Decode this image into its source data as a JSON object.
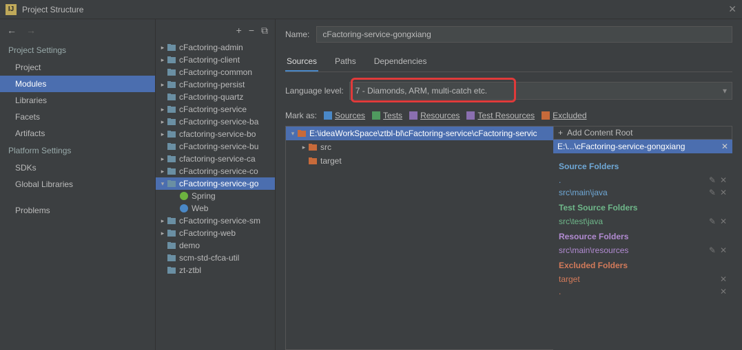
{
  "window": {
    "title": "Project Structure"
  },
  "left": {
    "project_settings_hdr": "Project Settings",
    "items1": [
      "Project",
      "Modules",
      "Libraries",
      "Facets",
      "Artifacts"
    ],
    "platform_hdr": "Platform Settings",
    "items2": [
      "SDKs",
      "Global Libraries"
    ],
    "problems": "Problems"
  },
  "tree": {
    "nodes": [
      {
        "label": "cFactoring-admin",
        "exp": ">"
      },
      {
        "label": "cFactoring-client",
        "exp": ">"
      },
      {
        "label": "cFactoring-common",
        "exp": ""
      },
      {
        "label": "cFactoring-persist",
        "exp": ">"
      },
      {
        "label": "cFactoring-quartz",
        "exp": ""
      },
      {
        "label": "cFactoring-service",
        "exp": ">"
      },
      {
        "label": "cFactoring-service-ba",
        "exp": ">"
      },
      {
        "label": "cfactoring-service-bo",
        "exp": ">"
      },
      {
        "label": "cFactoring-service-bu",
        "exp": ""
      },
      {
        "label": "cfactoring-service-ca",
        "exp": ">"
      },
      {
        "label": "cFactoring-service-co",
        "exp": ">"
      },
      {
        "label": "cFactoring-service-go",
        "exp": "v",
        "sel": true,
        "children": [
          {
            "label": "Spring",
            "icon": "spring"
          },
          {
            "label": "Web",
            "icon": "web"
          }
        ]
      },
      {
        "label": "cFactoring-service-sm",
        "exp": ">"
      },
      {
        "label": "cFactoring-web",
        "exp": ">"
      },
      {
        "label": "demo",
        "exp": ""
      },
      {
        "label": "scm-std-cfca-util",
        "exp": ""
      },
      {
        "label": "zt-ztbl",
        "exp": ""
      }
    ]
  },
  "right": {
    "name_label": "Name:",
    "name_value": "cFactoring-service-gongxiang",
    "tabs": [
      "Sources",
      "Paths",
      "Dependencies"
    ],
    "lang_label": "Language level:",
    "lang_value": "7 - Diamonds, ARM, multi-catch etc.",
    "mark_label": "Mark as:",
    "marks": [
      {
        "label": "Sources",
        "color": "#4a88c7"
      },
      {
        "label": "Tests",
        "color": "#4f9a5f"
      },
      {
        "label": "Resources",
        "color": "#8a6fb0"
      },
      {
        "label": "Test Resources",
        "color": "#8a6fb0"
      },
      {
        "label": "Excluded",
        "color": "#c76a3a"
      }
    ],
    "content_root": "E:\\ideaWorkSpace\\ztbl-bl\\cFactoring-service\\cFactoring-servic",
    "content_children": [
      "src",
      "target"
    ],
    "add_root": "Add Content Root",
    "root_short": "E:\\...\\cFactoring-service-gongxiang",
    "sections": {
      "source": {
        "hdr": "Source Folders",
        "items": [
          "src\\main\\java"
        ],
        "dot": "."
      },
      "test": {
        "hdr": "Test Source Folders",
        "items": [
          "src\\test\\java"
        ]
      },
      "resource": {
        "hdr": "Resource Folders",
        "items": [
          "src\\main\\resources"
        ]
      },
      "excluded": {
        "hdr": "Excluded Folders",
        "items": [
          "target"
        ],
        "dot": "."
      }
    }
  }
}
